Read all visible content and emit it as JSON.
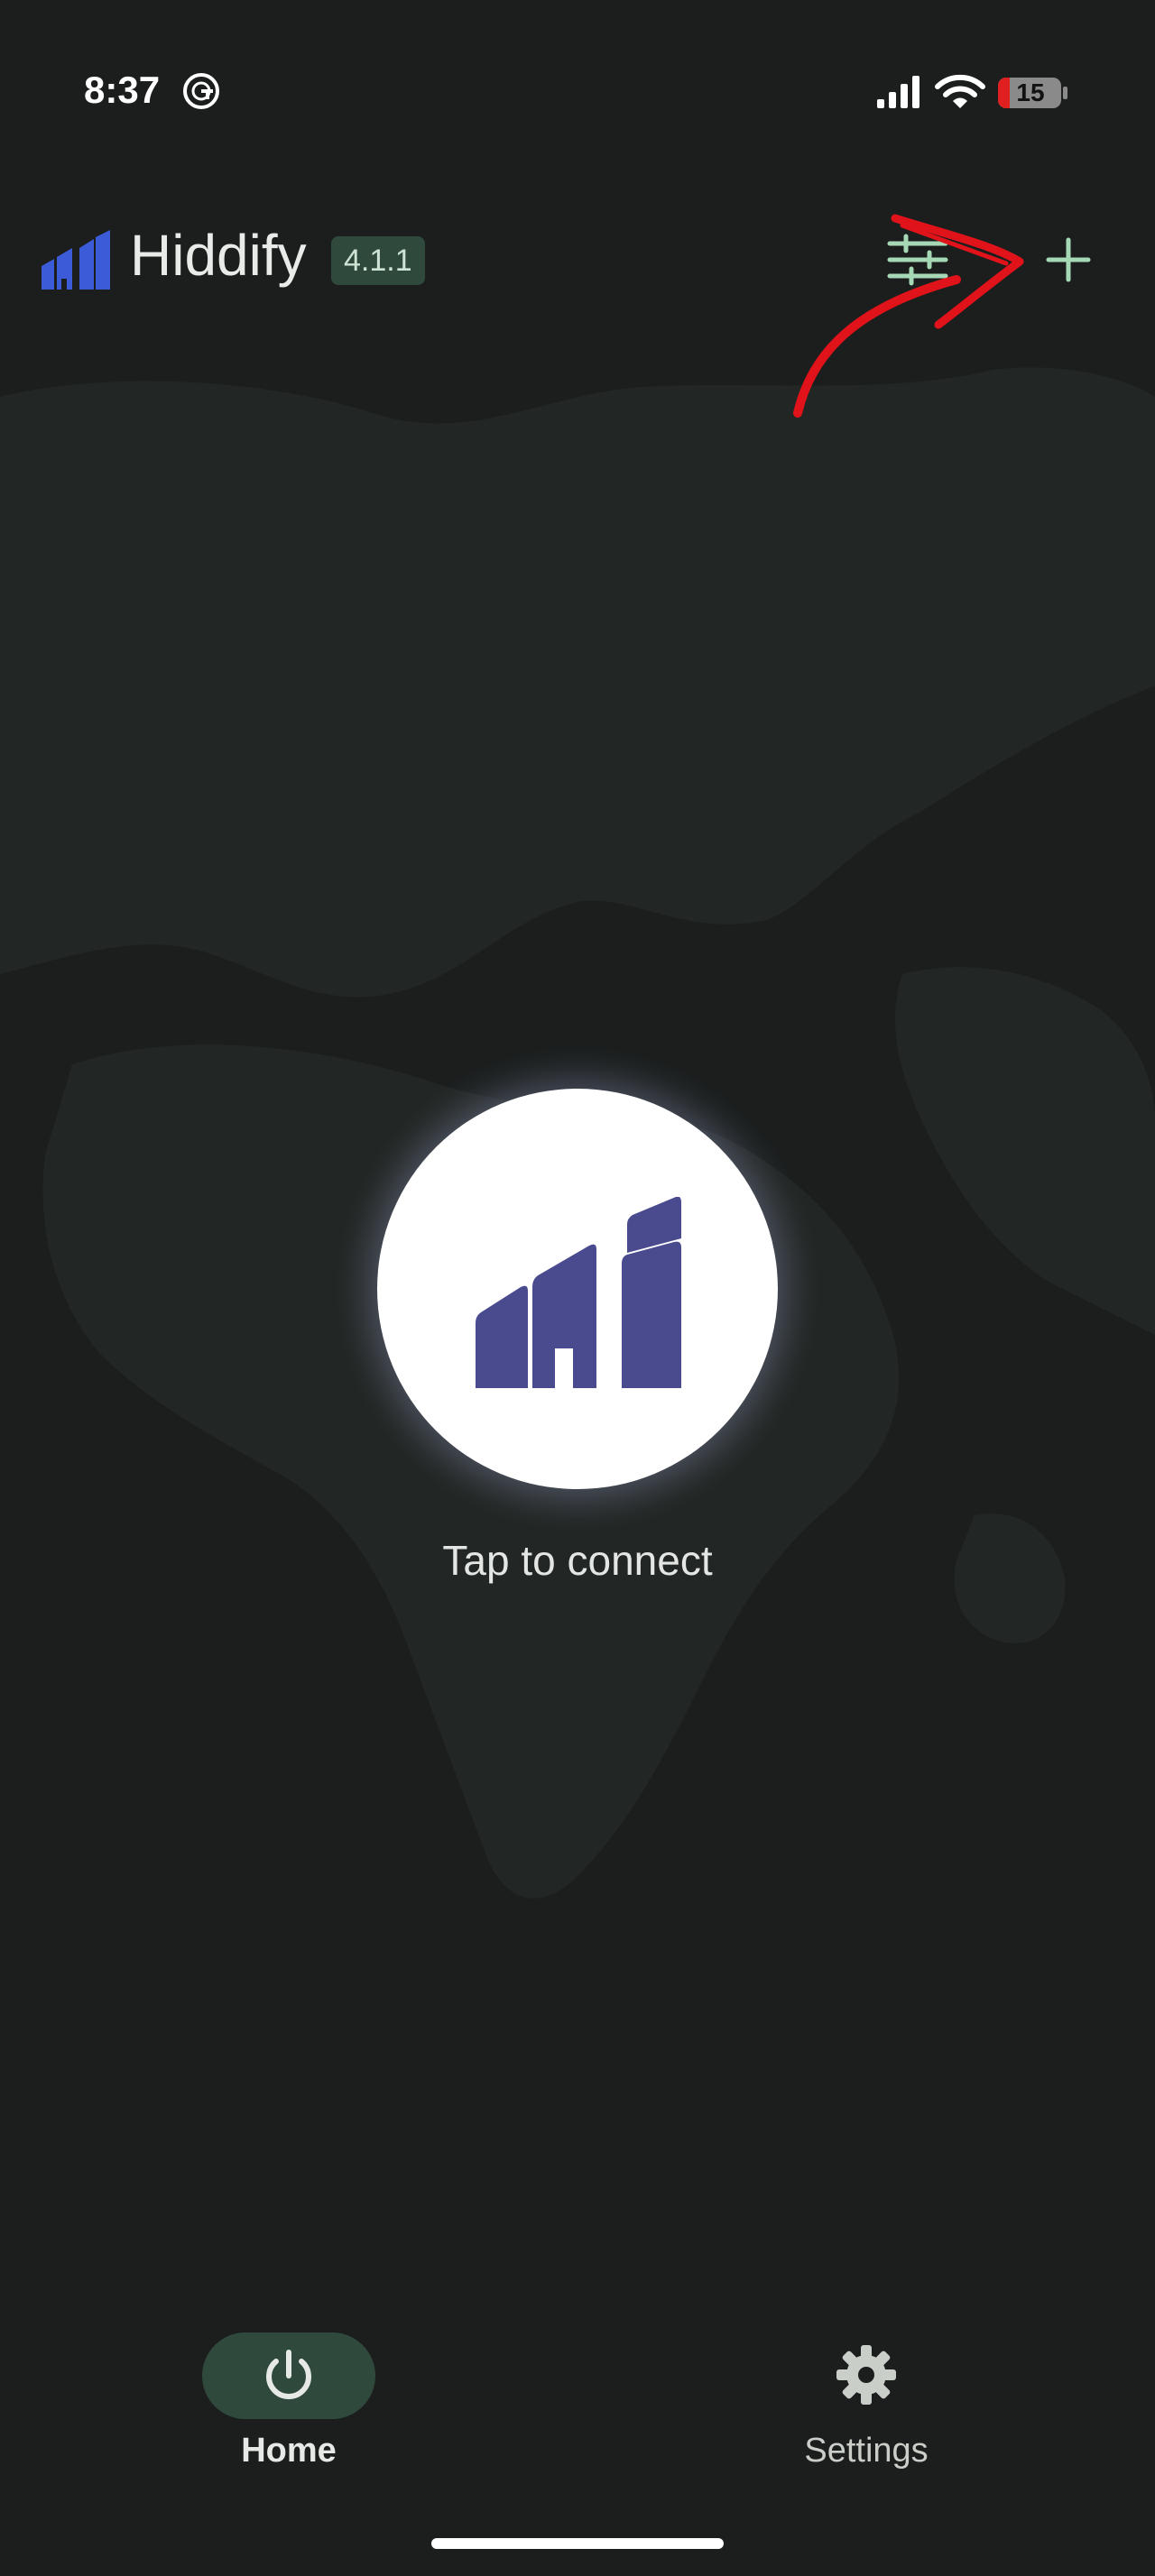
{
  "status_bar": {
    "time": "8:37",
    "battery": "15",
    "icons": [
      "grammarly-icon",
      "signal-icon",
      "wifi-icon",
      "battery-icon"
    ]
  },
  "app_bar": {
    "title": "Hiddify",
    "version": "4.1.1",
    "actions": [
      "filter-icon",
      "add-icon"
    ]
  },
  "main": {
    "connect_label": "Tap to connect"
  },
  "bottom_nav": {
    "items": [
      {
        "label": "Home",
        "icon": "power-icon",
        "active": true
      },
      {
        "label": "Settings",
        "icon": "gear-icon",
        "active": false
      }
    ]
  },
  "colors": {
    "background": "#1b1e1d",
    "brand_blue": "#3b5bd9",
    "logo_purple": "#4a4a8e",
    "accent_green": "#2f4a3c",
    "icon_green": "#a7d8b6",
    "annotation_red": "#e0121a"
  }
}
